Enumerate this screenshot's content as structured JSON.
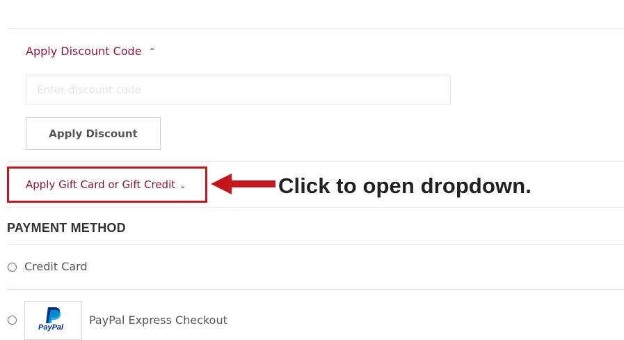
{
  "discount": {
    "toggle_label": "Apply Discount Code",
    "toggle_icon": "chevron-up-icon",
    "input_placeholder": "Enter discount code",
    "input_value": "",
    "apply_label": "Apply Discount"
  },
  "gift_card": {
    "toggle_label": "Apply Gift Card or Gift Credit",
    "toggle_icon": "chevron-down-icon"
  },
  "annotation": {
    "text": "Click to open dropdown.",
    "highlight_color": "#c4161c"
  },
  "payment": {
    "title": "PAYMENT METHOD",
    "options": [
      {
        "label": "Credit Card",
        "selected": false
      },
      {
        "label": "PayPal Express Checkout",
        "selected": false,
        "logo_text": "PayPal"
      }
    ]
  },
  "colors": {
    "link": "#8a1538",
    "highlight": "#c4161c",
    "paypal_dark": "#003087",
    "paypal_light": "#009cde"
  }
}
